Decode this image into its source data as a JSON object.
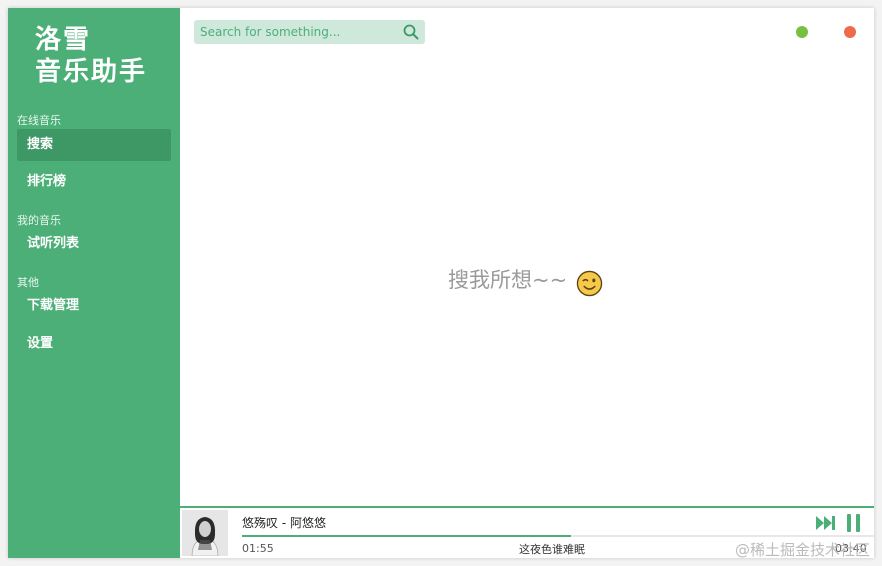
{
  "app": {
    "title_line1": "洛雪",
    "title_line2": "音乐助手"
  },
  "sidebar": {
    "sections": [
      {
        "title": "在线音乐"
      },
      {
        "title": "我的音乐"
      },
      {
        "title": "其他"
      }
    ],
    "items": [
      {
        "label": "搜索",
        "active": true
      },
      {
        "label": "排行榜"
      },
      {
        "label": "试听列表"
      },
      {
        "label": "下载管理"
      },
      {
        "label": "设置"
      }
    ]
  },
  "search": {
    "placeholder": "Search for something...",
    "value": ""
  },
  "main": {
    "empty_message": "搜我所想~~",
    "emoji": "wink-emoji"
  },
  "player": {
    "song_title": "悠殇叹 - 阿悠悠",
    "current_time": "01:55",
    "total_time": "03:40",
    "lyric": "这夜色谁难眠",
    "progress": 0.52
  },
  "watermark": "@稀土掘金技术社区",
  "colors": {
    "accent": "#4caf78",
    "accent_dark": "#3d9866",
    "minimize": "#78c043",
    "close": "#ee6a4d"
  }
}
